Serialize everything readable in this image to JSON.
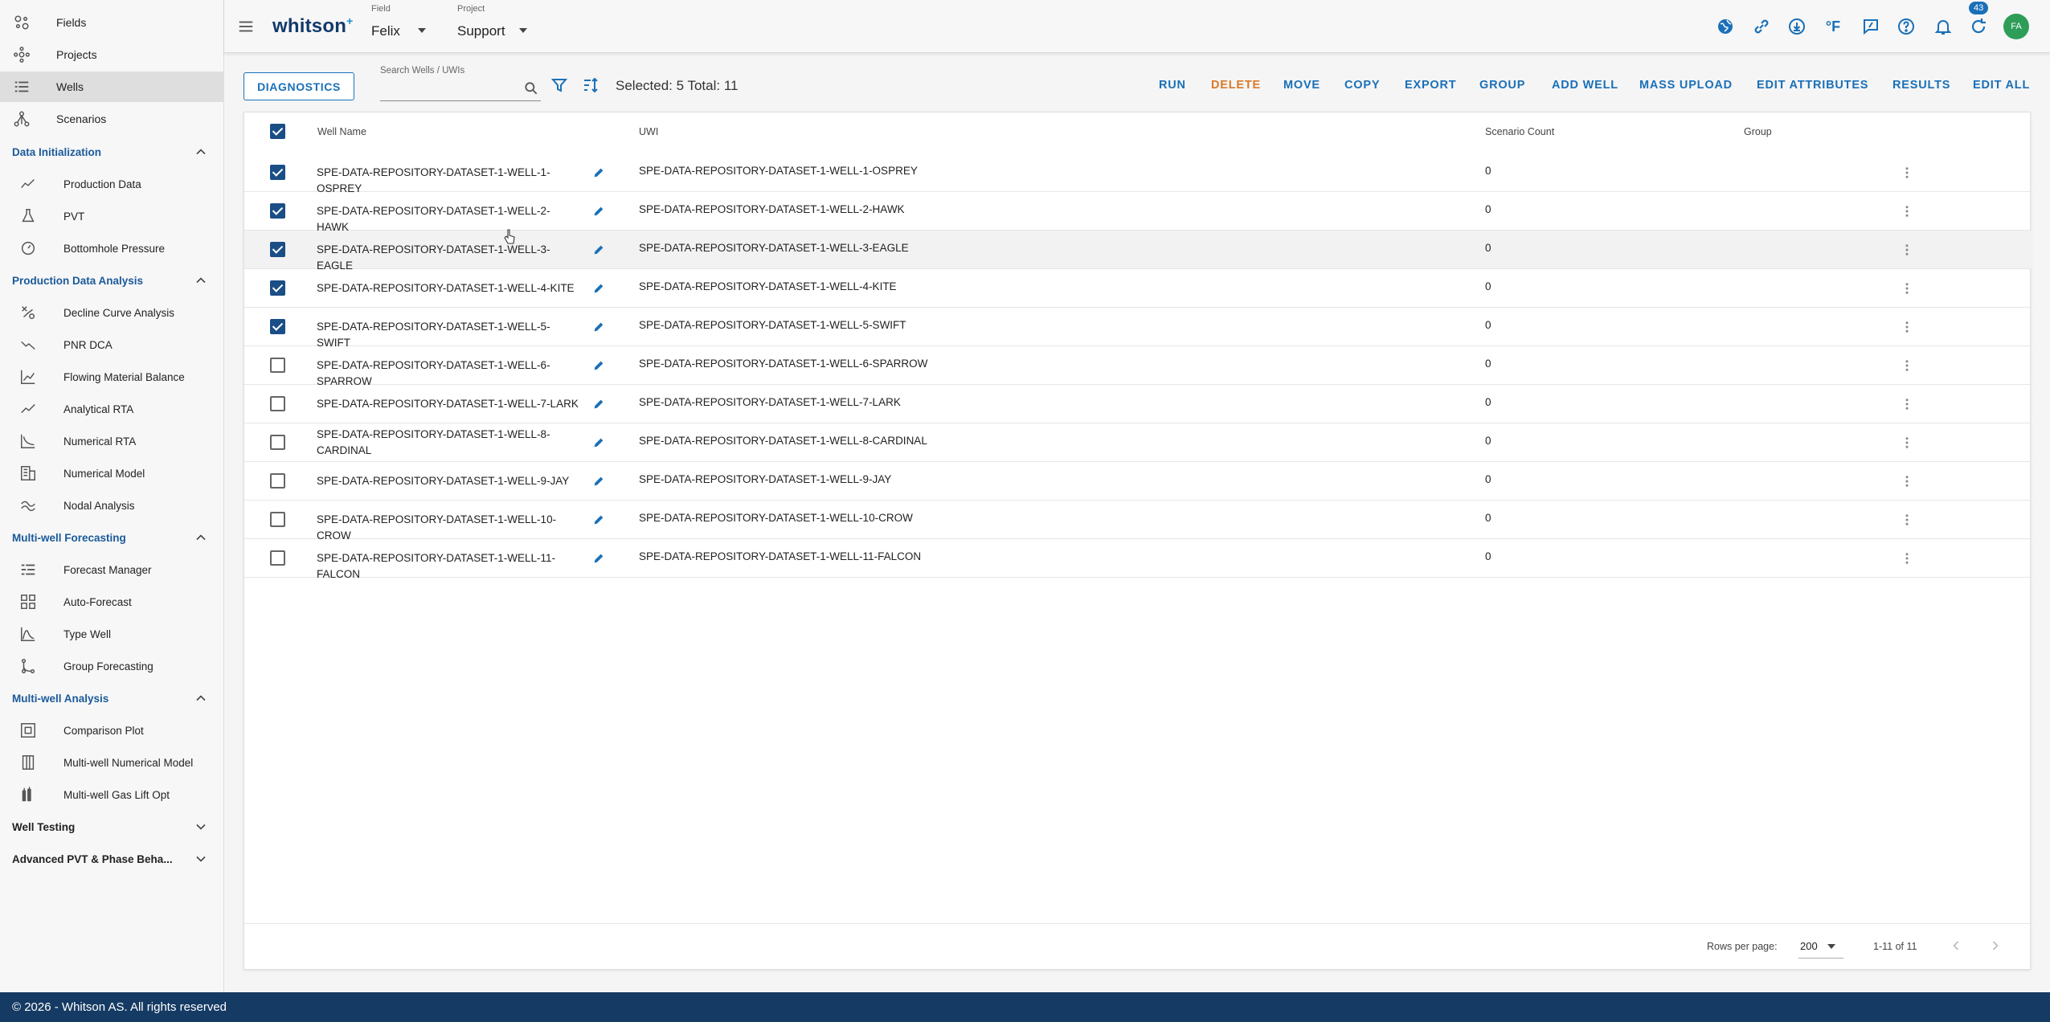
{
  "sidebar": {
    "top_items": [
      {
        "label": "Fields",
        "icon": "fields-icon"
      },
      {
        "label": "Projects",
        "icon": "projects-icon"
      },
      {
        "label": "Wells",
        "icon": "wells-icon",
        "active": true
      },
      {
        "label": "Scenarios",
        "icon": "scenarios-icon"
      }
    ],
    "sections": [
      {
        "title": "Data Initialization",
        "expanded": true,
        "items": [
          "Production Data",
          "PVT",
          "Bottomhole Pressure"
        ]
      },
      {
        "title": "Production Data Analysis",
        "expanded": true,
        "items": [
          "Decline Curve Analysis",
          "PNR DCA",
          "Flowing Material Balance",
          "Analytical RTA",
          "Numerical RTA",
          "Numerical Model",
          "Nodal Analysis"
        ]
      },
      {
        "title": "Multi-well Forecasting",
        "expanded": true,
        "items": [
          "Forecast Manager",
          "Auto-Forecast",
          "Type Well",
          "Group Forecasting"
        ]
      },
      {
        "title": "Multi-well Analysis",
        "expanded": true,
        "items": [
          "Comparison Plot",
          "Multi-well Numerical Model",
          "Multi-well Gas Lift Opt"
        ]
      },
      {
        "title": "Well Testing",
        "expanded": false,
        "items": []
      },
      {
        "title": "Advanced PVT & Phase Beha...",
        "expanded": false,
        "items": []
      }
    ]
  },
  "header": {
    "logo": "whitson",
    "logo_mark": "+",
    "field_label": "Field",
    "field_value": "Felix",
    "project_label": "Project",
    "project_value": "Support",
    "notification_count": "43",
    "temperature_unit": "°F",
    "avatar_initials": "FA"
  },
  "toolbar": {
    "diagnostics_label": "DIAGNOSTICS",
    "search_label": "Search Wells / UWIs",
    "search_value": "",
    "selection_summary": "Selected: 5 Total: 11",
    "actions": [
      "RUN",
      "DELETE",
      "MOVE",
      "COPY",
      "EXPORT",
      "GROUP",
      "ADD WELL",
      "MASS UPLOAD",
      "EDIT ATTRIBUTES",
      "RESULTS",
      "EDIT ALL"
    ]
  },
  "table": {
    "columns": {
      "well_name": "Well Name",
      "uwi": "UWI",
      "scenario_count": "Scenario Count",
      "group": "Group"
    },
    "rows": [
      {
        "name": "SPE-DATA-REPOSITORY-DATASET-1-WELL-1-OSPREY",
        "uwi": "SPE-DATA-REPOSITORY-DATASET-1-WELL-1-OSPREY",
        "scenario_count": "0",
        "checked": true
      },
      {
        "name": "SPE-DATA-REPOSITORY-DATASET-1-WELL-2-HAWK",
        "uwi": "SPE-DATA-REPOSITORY-DATASET-1-WELL-2-HAWK",
        "scenario_count": "0",
        "checked": true
      },
      {
        "name": "SPE-DATA-REPOSITORY-DATASET-1-WELL-3-EAGLE",
        "uwi": "SPE-DATA-REPOSITORY-DATASET-1-WELL-3-EAGLE",
        "scenario_count": "0",
        "checked": true
      },
      {
        "name": "SPE-DATA-REPOSITORY-DATASET-1-WELL-4-KITE",
        "uwi": "SPE-DATA-REPOSITORY-DATASET-1-WELL-4-KITE",
        "scenario_count": "0",
        "checked": true
      },
      {
        "name": "SPE-DATA-REPOSITORY-DATASET-1-WELL-5-SWIFT",
        "uwi": "SPE-DATA-REPOSITORY-DATASET-1-WELL-5-SWIFT",
        "scenario_count": "0",
        "checked": true
      },
      {
        "name": "SPE-DATA-REPOSITORY-DATASET-1-WELL-6-SPARROW",
        "uwi": "SPE-DATA-REPOSITORY-DATASET-1-WELL-6-SPARROW",
        "scenario_count": "0",
        "checked": false
      },
      {
        "name": "SPE-DATA-REPOSITORY-DATASET-1-WELL-7-LARK",
        "uwi": "SPE-DATA-REPOSITORY-DATASET-1-WELL-7-LARK",
        "scenario_count": "0",
        "checked": false
      },
      {
        "name": "SPE-DATA-REPOSITORY-DATASET-1-WELL-8-CARDINAL",
        "uwi": "SPE-DATA-REPOSITORY-DATASET-1-WELL-8-CARDINAL",
        "scenario_count": "0",
        "checked": false
      },
      {
        "name": "SPE-DATA-REPOSITORY-DATASET-1-WELL-9-JAY",
        "uwi": "SPE-DATA-REPOSITORY-DATASET-1-WELL-9-JAY",
        "scenario_count": "0",
        "checked": false
      },
      {
        "name": "SPE-DATA-REPOSITORY-DATASET-1-WELL-10-CROW",
        "uwi": "SPE-DATA-REPOSITORY-DATASET-1-WELL-10-CROW",
        "scenario_count": "0",
        "checked": false
      },
      {
        "name": "SPE-DATA-REPOSITORY-DATASET-1-WELL-11-FALCON",
        "uwi": "SPE-DATA-REPOSITORY-DATASET-1-WELL-11-FALCON",
        "scenario_count": "0",
        "checked": false
      }
    ]
  },
  "pagination": {
    "rows_per_page_label": "Rows per page:",
    "rows_per_page_value": "200",
    "range": "1-11 of 11"
  },
  "footer": {
    "copyright": "© 2026 - Whitson AS. All rights reserved"
  },
  "colors": {
    "accent": "#1a70b8",
    "danger": "#d97a2a",
    "nav_section": "#1a5a9a",
    "statusbar": "#153a63",
    "avatar": "#2e9d58"
  }
}
